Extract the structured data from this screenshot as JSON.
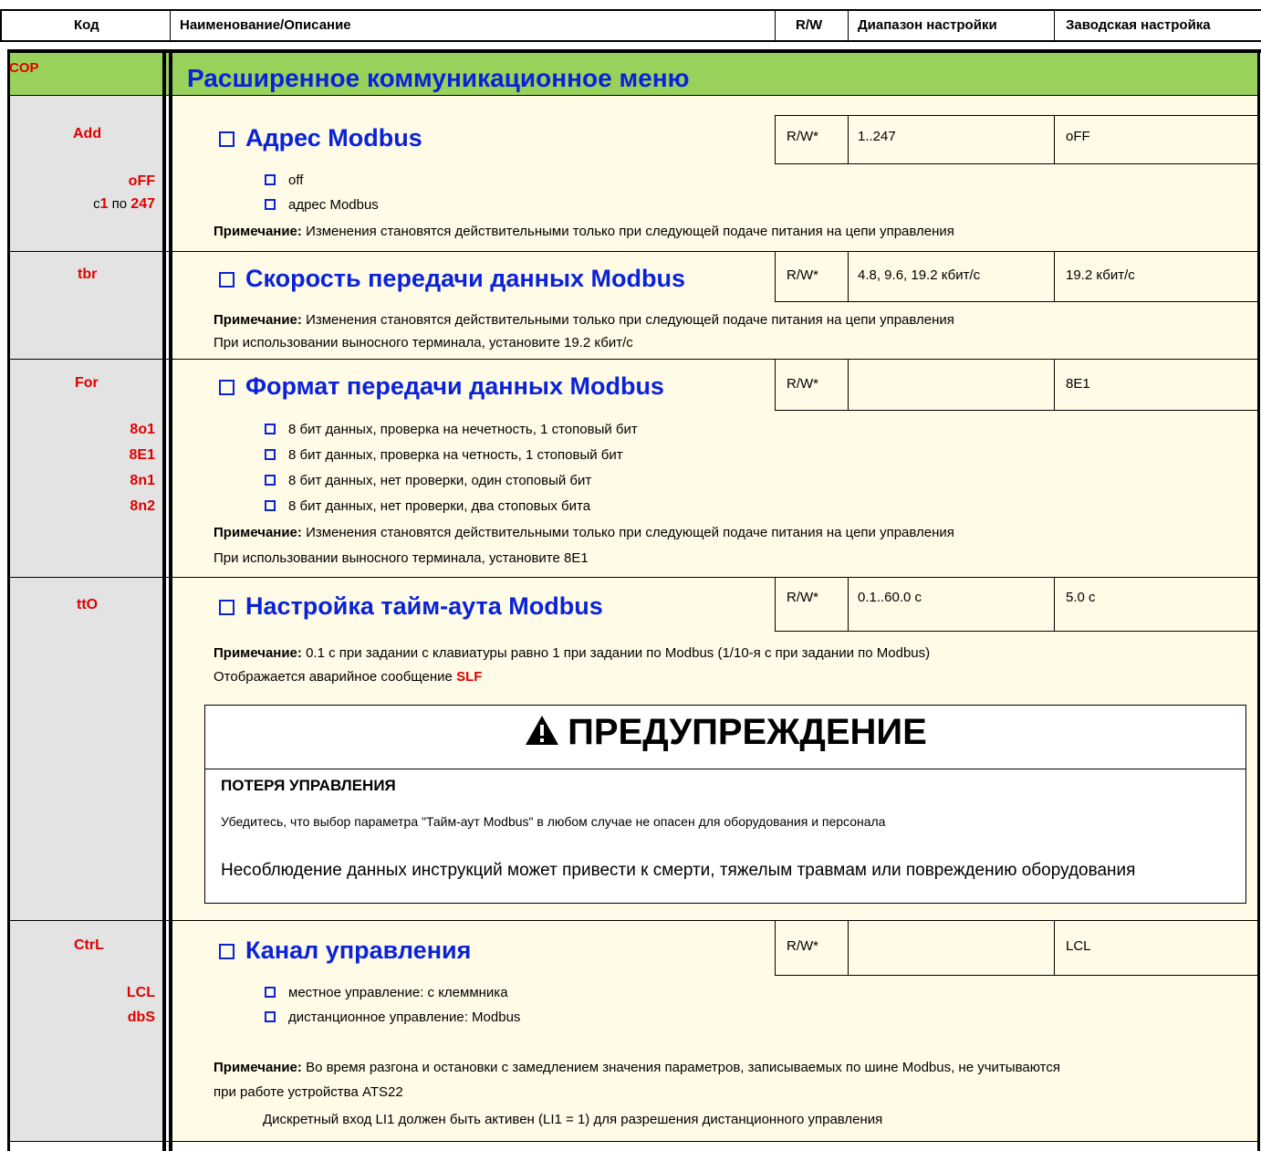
{
  "header": {
    "col_code": "Код",
    "col_name": "Наименование/Описание",
    "col_rw": "R/W",
    "col_range": "Диапазон настройки",
    "col_factory": "Заводская настройка"
  },
  "menu": {
    "code": "COP",
    "title": "Расширенное коммуникационное меню"
  },
  "add": {
    "code": "Add",
    "title": "Адрес Modbus",
    "rw": "R/W*",
    "range": "1..247",
    "factory": "oFF",
    "opt_codes": {
      "off": "oFF",
      "from": "с",
      "v1": "1",
      "to": "по",
      "v2": "247"
    },
    "options": [
      "off",
      "адрес Modbus"
    ],
    "note_label": "Примечание:",
    "note_text": " Изменения становятся действительными только при следующей подаче питания на цепи управления"
  },
  "tbr": {
    "code": "tbr",
    "title": "Скорость передачи данных Modbus",
    "rw": "R/W*",
    "range": "4.8, 9.6, 19.2 кбит/с",
    "factory": "19.2 кбит/с",
    "note_label": "Примечание:",
    "note_text": " Изменения становятся действительными только при следующей подаче питания на цепи управления",
    "extra": "При использовании выносного терминала, установите 19.2 кбит/с"
  },
  "for": {
    "code": "For",
    "title": "Формат передачи данных Modbus",
    "rw": "R/W*",
    "range": "",
    "factory": "8E1",
    "codes": [
      "8o1",
      "8E1",
      "8n1",
      "8n2"
    ],
    "options": [
      "8 бит данных, проверка на нечетность, 1 стоповый бит",
      "8 бит данных, проверка на четность, 1 стоповый бит",
      "8 бит данных, нет проверки, один стоповый бит",
      "8 бит данных, нет проверки, два стоповых бита"
    ],
    "note_label": "Примечание:",
    "note_text": " Изменения становятся действительными только при следующей подаче питания на цепи управления",
    "extra": "При использовании выносного терминала, установите 8E1"
  },
  "tto": {
    "code": "ttO",
    "title": "Настройка тайм-аута Modbus",
    "rw": "R/W*",
    "range": "0.1..60.0 с",
    "factory": "5.0 с",
    "note_label": "Примечание:",
    "note_text": " 0.1 с при задании с клавиатуры равно 1 при задании по Modbus (1/10-я с при задании по Modbus)",
    "alarm_text": "Отображается аварийное сообщение ",
    "alarm_code": "SLF",
    "warning": {
      "title": "ПРЕДУПРЕЖДЕНИЕ",
      "subtitle": "ПОТЕРЯ УПРАВЛЕНИЯ",
      "line1": "Убедитесь, что выбор параметра \"Тайм-аут Modbus\" в любом случае не опасен для оборудования и персонала",
      "line2": "Несоблюдение данных инструкций может привести к смерти, тяжелым травмам или повреждению оборудования"
    }
  },
  "ctrl": {
    "code": "CtrL",
    "title": "Канал управления",
    "rw": "R/W*",
    "range": "",
    "factory": "LCL",
    "codes": [
      "LCL",
      "dbS"
    ],
    "options": [
      "местное управление: с клеммника",
      "дистанционное управление: Modbus"
    ],
    "note_label": "Примечание:",
    "note_text": " Во время разгона и остановки с замедлением значения параметров, записываемых по шине Modbus, не учитываются",
    "note_text2": "при работе устройства ATS22",
    "extra": "Дискретный вход LI1 должен быть активен (LI1 = 1) для разрешения дистанционного управления"
  },
  "colors": {
    "menu_bg": "#99d25a",
    "code_bg": "#e3e3e3",
    "body_bg": "#fffbe6",
    "title_blue": "#0a23d8",
    "code_red": "#e00000"
  }
}
